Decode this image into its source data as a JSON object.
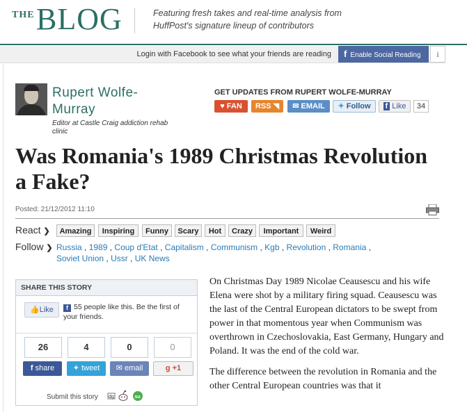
{
  "header": {
    "logo_the": "THE",
    "logo_blog": "BLOG",
    "tagline": "Featuring fresh takes and real-time analysis from HuffPost's signature lineup of contributors"
  },
  "facebook_bar": {
    "text": "Login with Facebook to see what your friends are reading",
    "enable_label": "Enable Social Reading",
    "info_label": "i"
  },
  "author": {
    "name": "Rupert Wolfe-Murray",
    "bio": "Editor at Castle Craig addiction rehab clinic"
  },
  "updates": {
    "title": "GET UPDATES FROM RUPERT WOLFE-MURRAY",
    "fan": "FAN",
    "rss": "RSS",
    "email": "EMAIL",
    "follow": "Follow",
    "like": "Like",
    "like_count": "34"
  },
  "article": {
    "title": "Was Romania's 1989 Christmas Revolution a Fake?",
    "posted": "Posted: 21/12/2012 11:10",
    "paragraphs": [
      "On Christmas Day 1989 Nicolae Ceausescu and his wife Elena were shot by a military firing squad. Ceausescu was the last of the Central European dictators to be swept from power in that momentous year when Communism was overthrown in Czechoslovakia, East Germany, Hungary and Poland. It was the end of the cold war.",
      "The difference between the revolution in Romania and the other Central European countries was that it"
    ]
  },
  "react": {
    "label": "React",
    "tags": [
      "Amazing",
      "Inspiring",
      "Funny",
      "Scary",
      "Hot",
      "Crazy",
      "Important",
      "Weird"
    ]
  },
  "follow": {
    "label": "Follow",
    "tags": [
      "Russia",
      "1989",
      "Coup d'Etat",
      "Capitalism",
      "Communism",
      "Kgb",
      "Revolution",
      "Romania",
      "Soviet Union",
      "Ussr",
      "UK News"
    ]
  },
  "share": {
    "title": "SHARE THIS STORY",
    "like": "Like",
    "fb_text": "55 people like this. Be the first of your friends.",
    "counts": [
      "26",
      "4",
      "0",
      "0"
    ],
    "share_label": "share",
    "tweet_label": "tweet",
    "email_label": "email",
    "gplus_label": "+1",
    "submit": "Submit this story"
  },
  "icons": {
    "fan": "heart-icon",
    "rss": "rss-icon",
    "email": "envelope-icon",
    "follow": "twitter-bird-icon",
    "like": "facebook-icon",
    "print": "printer-icon"
  }
}
